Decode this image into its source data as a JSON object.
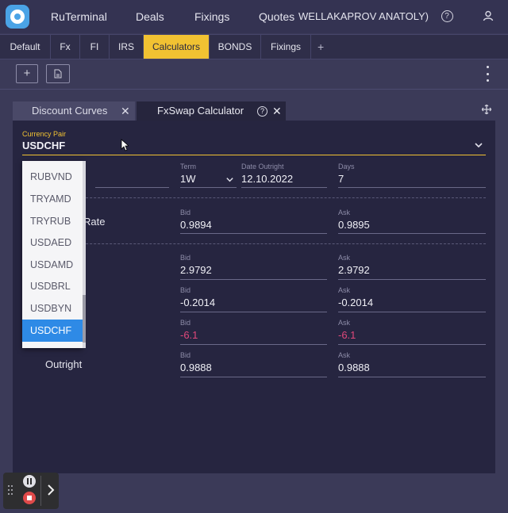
{
  "header": {
    "nav": [
      "RuTerminal",
      "Deals",
      "Fixings",
      "Quotes"
    ],
    "user": "WELLAKAPROV ANATOLY)",
    "icons": [
      "logo-icon",
      "help-icon",
      "user-icon"
    ]
  },
  "tabs": {
    "items": [
      "Default",
      "Fx",
      "FI",
      "IRS",
      "Calculators",
      "BONDS",
      "Fixings"
    ],
    "active": "Calculators",
    "add_label": "+"
  },
  "toolbar": {
    "add_label": "+",
    "doc_icon": "document-icon",
    "menu_icon": "more-vertical-icon"
  },
  "panels": {
    "discount_curves": "Discount Curves",
    "fxswap": "FxSwap Calculator",
    "close_symbol": "✕",
    "help_symbol": "?"
  },
  "form": {
    "currency_pair_label": "Currency Pair",
    "currency_pair": "USDCHF",
    "term_label": "Term",
    "term": "1W",
    "date_outright_label": "Date Outright",
    "date_outright": "12.10.2022",
    "days_label": "Days",
    "days": "7",
    "rate_label_fragment": "Rate",
    "outright_label": "Outright",
    "bid_label": "Bid",
    "ask_label": "Ask",
    "spot": {
      "bid": "0.9894",
      "ask": "0.9895"
    },
    "row1": {
      "bid": "2.9792",
      "ask": "2.9792"
    },
    "row2": {
      "bid": "-0.2014",
      "ask": "-0.2014"
    },
    "row3": {
      "bid": "-6.1",
      "ask": "-6.1"
    },
    "outright": {
      "bid": "0.9888",
      "ask": "0.9888"
    }
  },
  "dropdown": {
    "options": [
      "RUBVND",
      "TRYAMD",
      "TRYRUB",
      "USDAED",
      "USDAMD",
      "USDBRL",
      "USDBYN",
      "USDCHF"
    ],
    "selected": "USDCHF"
  },
  "colors": {
    "accent": "#f1c232",
    "negative": "#e0487a",
    "selected": "#2e8ae6"
  }
}
